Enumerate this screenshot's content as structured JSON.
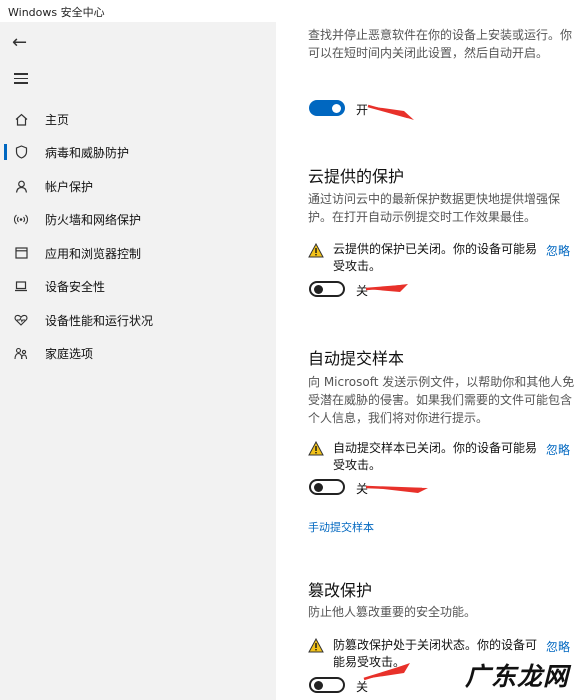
{
  "window": {
    "title": "Windows 安全中心"
  },
  "sidebar": {
    "items": [
      {
        "label": "主页",
        "icon": "home-icon"
      },
      {
        "label": "病毒和威胁防护",
        "icon": "shield-icon"
      },
      {
        "label": "帐户保护",
        "icon": "person-icon"
      },
      {
        "label": "防火墙和网络保护",
        "icon": "wifi-icon"
      },
      {
        "label": "应用和浏览器控制",
        "icon": "app-window-icon"
      },
      {
        "label": "设备安全性",
        "icon": "laptop-icon"
      },
      {
        "label": "设备性能和运行状况",
        "icon": "heart-icon"
      },
      {
        "label": "家庭选项",
        "icon": "family-icon"
      }
    ]
  },
  "realtime": {
    "description": "查找并停止恶意软件在你的设备上安装或运行。你可以在短时间内关闭此设置，然后自动开启。",
    "state": "开",
    "on": true
  },
  "cloud": {
    "title": "云提供的保护",
    "description": "通过访问云中的最新保护数据更快地提供增强保护。在打开自动示例提交时工作效果最佳。",
    "warning": "云提供的保护已关闭。你的设备可能易受攻击。",
    "dismiss": "忽略",
    "state": "关",
    "on": false
  },
  "sample": {
    "title": "自动提交样本",
    "description": "向 Microsoft 发送示例文件，以帮助你和其他人免受潜在威胁的侵害。如果我们需要的文件可能包含个人信息，我们将对你进行提示。",
    "warning": "自动提交样本已关闭。你的设备可能易受攻击。",
    "dismiss": "忽略",
    "state": "关",
    "on": false,
    "manual_link": "手动提交样本"
  },
  "tamper": {
    "title": "篡改保护",
    "description": "防止他人篡改重要的安全功能。",
    "warning": "防篡改保护处于关闭状态。你的设备可能易受攻击。",
    "dismiss": "忽略",
    "state": "关",
    "on": false
  },
  "watermark": {
    "text": "广东龙网"
  },
  "colors": {
    "accent": "#0067c0",
    "annotation_arrow": "#e8312a",
    "warning": "#f2c21a"
  }
}
